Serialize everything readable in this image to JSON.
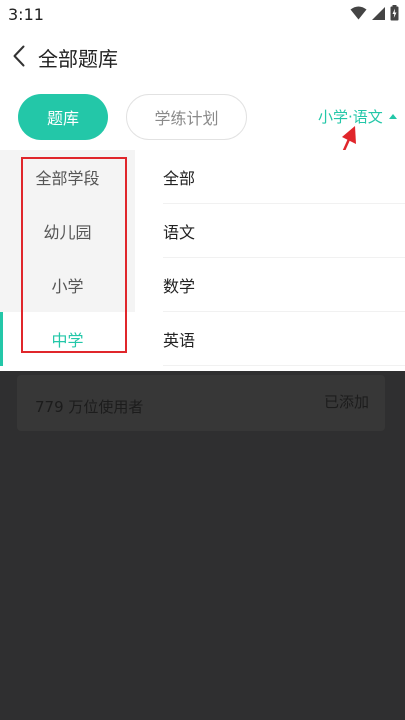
{
  "status_bar": {
    "time": "3:11",
    "icons": [
      "wifi-icon",
      "signal-icon",
      "battery-icon"
    ]
  },
  "header": {
    "back_icon": "chevron-left-icon",
    "title": "全部题库"
  },
  "tabs": [
    {
      "label": "题库",
      "active": true
    },
    {
      "label": "学练计划",
      "active": false
    }
  ],
  "filter": {
    "label": "小学·语文",
    "icon": "caret-up-icon"
  },
  "dropdown": {
    "levels": [
      {
        "label": "全部学段",
        "active": false
      },
      {
        "label": "幼儿园",
        "active": false
      },
      {
        "label": "小学",
        "active": false
      },
      {
        "label": "中学",
        "active": true
      }
    ],
    "subjects": [
      {
        "label": "全部"
      },
      {
        "label": "语文"
      },
      {
        "label": "数学"
      },
      {
        "label": "英语"
      }
    ]
  },
  "background_card": {
    "users_text": "779 万位使用者",
    "added_label": "已添加"
  },
  "colors": {
    "accent": "#23c7a8",
    "annotation": "#e0262b",
    "overlay": "#2f2f30"
  }
}
